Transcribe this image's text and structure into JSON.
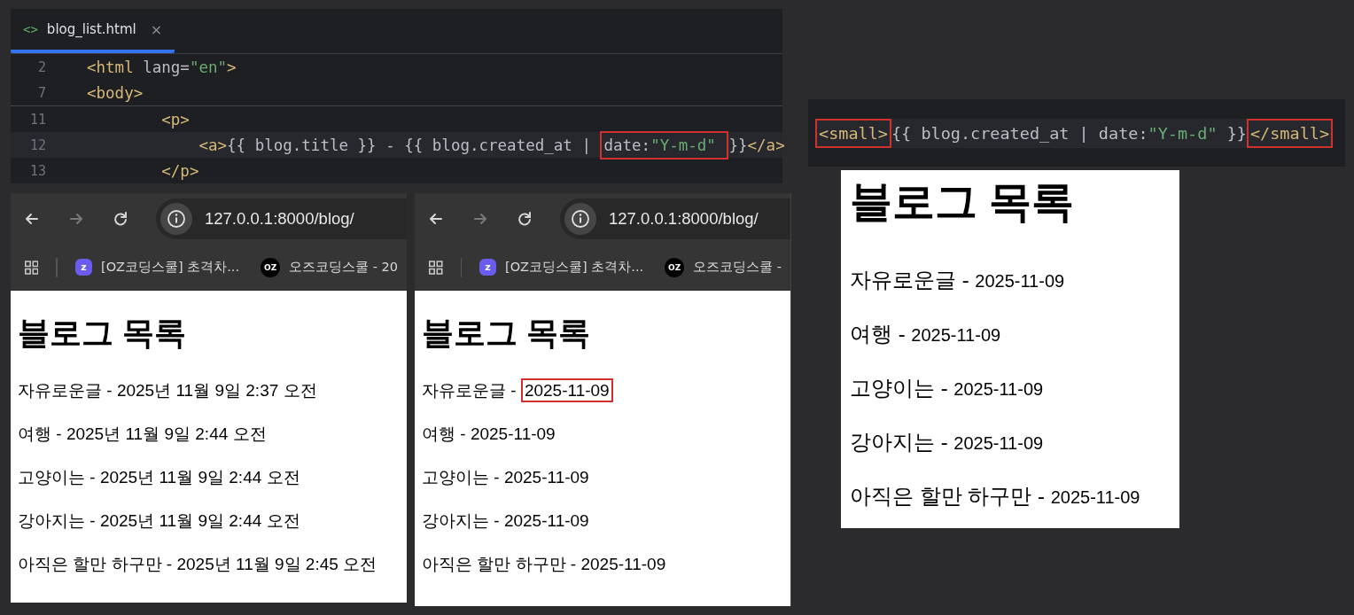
{
  "editor": {
    "tab": {
      "icon_text": "<>",
      "label": "blog_list.html",
      "close": "×",
      "selected": true
    },
    "sticky_lines": [
      {
        "number": "2",
        "tokens": [
          {
            "kind": "tag",
            "text": "<html "
          },
          {
            "kind": "plain",
            "text": "lang="
          },
          {
            "kind": "string",
            "text": "\"en\""
          },
          {
            "kind": "tag",
            "text": ">"
          }
        ]
      },
      {
        "number": "7",
        "tokens": [
          {
            "kind": "tag",
            "text": "<body>"
          }
        ]
      }
    ],
    "lines": [
      {
        "number": "11",
        "current": false,
        "tokens": [
          {
            "kind": "tag",
            "text": "<p>"
          }
        ],
        "children": [
          {
            "number": "12",
            "current": true,
            "tokens": [
              {
                "kind": "tag",
                "text": "<a>"
              },
              {
                "kind": "plain",
                "text": "{{ blog.title }} - {{ blog.created_at | "
              },
              {
                "kind": "box",
                "parts": [
                  {
                    "kind": "plain",
                    "text": "date:"
                  },
                  {
                    "kind": "string",
                    "text": "\"Y-m-d\" "
                  }
                ]
              },
              {
                "kind": "plain",
                "text": "}}"
              },
              {
                "kind": "tag",
                "text": "</a>"
              }
            ]
          }
        ]
      },
      {
        "number": "13",
        "current": false,
        "tokens": [
          {
            "kind": "tag",
            "text": "</p>"
          }
        ]
      }
    ]
  },
  "browsers": [
    {
      "nav": [
        {
          "kind": "back",
          "disabled": false
        },
        {
          "kind": "forward",
          "disabled": true
        },
        {
          "kind": "reload",
          "disabled": false
        }
      ],
      "url": "127.0.0.1:8000/blog/",
      "bookmarks": [
        {
          "kind": "hex",
          "icon_text": "z",
          "label": "[OZ코딩스쿨] 초격차..."
        },
        {
          "kind": "circle",
          "icon_text": "OZ",
          "label": "오즈코딩스쿨 - 20"
        }
      ],
      "heading": "블로그 목록",
      "items": [
        {
          "title": "자유로운글 - ",
          "date": "2025년 11월 9일 2:37 오전",
          "boxed": false
        },
        {
          "title": "여행 - ",
          "date": "2025년 11월 9일 2:44 오전",
          "boxed": false
        },
        {
          "title": "고양이는 - ",
          "date": "2025년 11월 9일 2:44 오전",
          "boxed": false
        },
        {
          "title": "강아지는 - ",
          "date": "2025년 11월 9일 2:44 오전",
          "boxed": false
        },
        {
          "title": "아직은 할만 하구만 - ",
          "date": "2025년 11월 9일 2:45 오전",
          "boxed": false
        }
      ]
    },
    {
      "nav": [
        {
          "kind": "back",
          "disabled": false
        },
        {
          "kind": "forward",
          "disabled": true
        },
        {
          "kind": "reload",
          "disabled": false
        }
      ],
      "url": "127.0.0.1:8000/blog/",
      "bookmarks": [
        {
          "kind": "hex",
          "icon_text": "z",
          "label": "[OZ코딩스쿨] 초격차..."
        },
        {
          "kind": "circle",
          "icon_text": "OZ",
          "label": "오즈코딩스쿨 -"
        }
      ],
      "heading": "블로그 목록",
      "items": [
        {
          "title": "자유로운글 - ",
          "date": "2025-11-09",
          "boxed": true
        },
        {
          "title": "여행 - ",
          "date": "2025-11-09",
          "boxed": false
        },
        {
          "title": "고양이는 - ",
          "date": "2025-11-09",
          "boxed": false
        },
        {
          "title": "강아지는 - ",
          "date": "2025-11-09",
          "boxed": false
        },
        {
          "title": "아직은 할만 하구만 - ",
          "date": "2025-11-09",
          "boxed": false
        }
      ]
    }
  ],
  "snippet": {
    "tokens": [
      {
        "kind": "box",
        "parts": [
          {
            "kind": "tag",
            "text": "<small>"
          }
        ]
      },
      {
        "kind": "plain",
        "text": "{{ blog.created_at | date:"
      },
      {
        "kind": "string",
        "text": "\"Y-m-d\""
      },
      {
        "kind": "plain",
        "text": " }}"
      },
      {
        "kind": "box",
        "parts": [
          {
            "kind": "tag",
            "text": "</small>"
          }
        ]
      }
    ]
  },
  "result_page": {
    "heading": "블로그 목록",
    "items": [
      {
        "title": "자유로운글 - ",
        "date": "2025-11-09"
      },
      {
        "title": "여행 - ",
        "date": "2025-11-09"
      },
      {
        "title": "고양이는 - ",
        "date": "2025-11-09"
      },
      {
        "title": "강아지는 - ",
        "date": "2025-11-09"
      },
      {
        "title": "아직은 할만 하구만 - ",
        "date": "2025-11-09"
      }
    ]
  }
}
